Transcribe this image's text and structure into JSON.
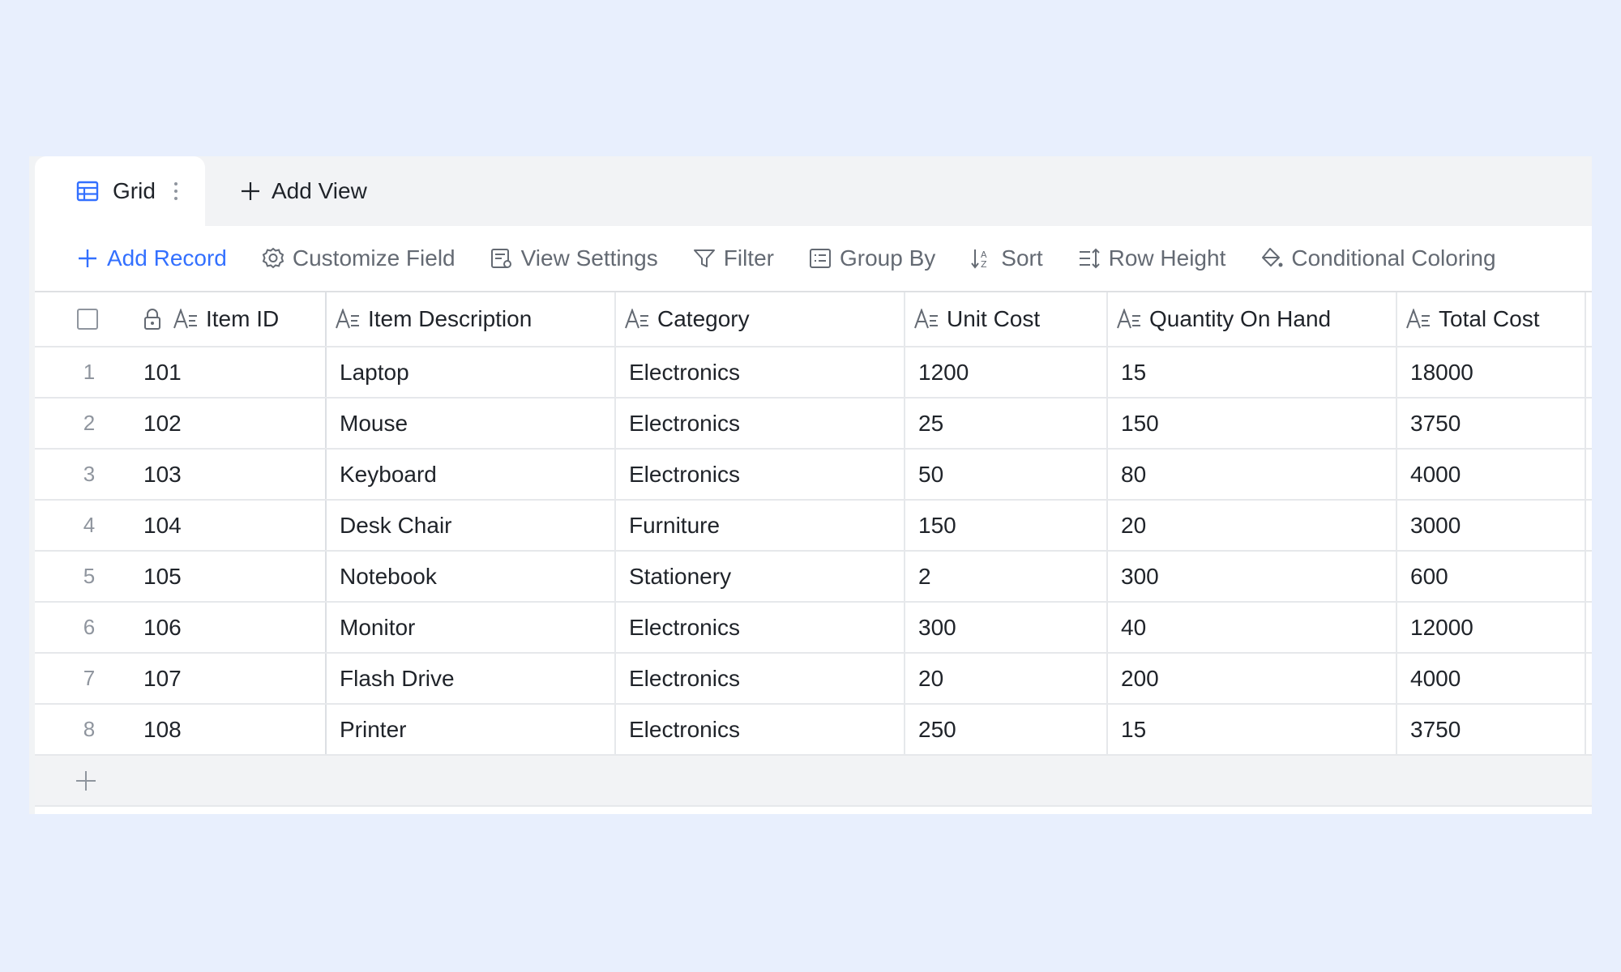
{
  "tabs": {
    "active_label": "Grid",
    "add_view_label": "Add View"
  },
  "toolbar": {
    "add_record": "Add Record",
    "customize_field": "Customize Field",
    "view_settings": "View Settings",
    "filter": "Filter",
    "group_by": "Group By",
    "sort": "Sort",
    "row_height": "Row Height",
    "conditional_coloring": "Conditional Coloring"
  },
  "columns": [
    "Item ID",
    "Item Description",
    "Category",
    "Unit Cost",
    "Quantity On Hand",
    "Total Cost"
  ],
  "rows": [
    {
      "num": "1",
      "cells": [
        "101",
        "Laptop",
        "Electronics",
        "1200",
        "15",
        "18000"
      ]
    },
    {
      "num": "2",
      "cells": [
        "102",
        "Mouse",
        "Electronics",
        "25",
        "150",
        "3750"
      ]
    },
    {
      "num": "3",
      "cells": [
        "103",
        "Keyboard",
        "Electronics",
        "50",
        "80",
        "4000"
      ]
    },
    {
      "num": "4",
      "cells": [
        "104",
        "Desk Chair",
        "Furniture",
        "150",
        "20",
        "3000"
      ]
    },
    {
      "num": "5",
      "cells": [
        "105",
        "Notebook",
        "Stationery",
        "2",
        "300",
        "600"
      ]
    },
    {
      "num": "6",
      "cells": [
        "106",
        "Monitor",
        "Electronics",
        "300",
        "40",
        "12000"
      ]
    },
    {
      "num": "7",
      "cells": [
        "107",
        "Flash Drive",
        "Electronics",
        "20",
        "200",
        "4000"
      ]
    },
    {
      "num": "8",
      "cells": [
        "108",
        "Printer",
        "Electronics",
        "250",
        "15",
        "3750"
      ]
    }
  ],
  "colors": {
    "accent": "#3370ff",
    "muted": "#646a73",
    "background": "#e8effd"
  }
}
